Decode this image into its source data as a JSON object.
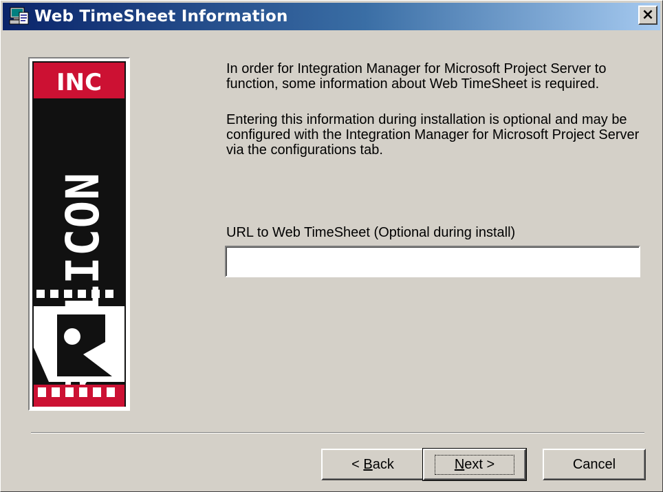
{
  "window": {
    "title": "Web TimeSheet Information",
    "close_label": "×"
  },
  "logo": {
    "top_text": "INC",
    "wordmark": "REPLICON",
    "letter": "R",
    "colors": {
      "red": "#cc1133",
      "black": "#111111",
      "white": "#ffffff"
    }
  },
  "content": {
    "info_paragraph_1": "In order for Integration Manager for Microsoft Project Server to function, some information about Web TimeSheet is required.",
    "info_paragraph_2": "Entering this information during installation is optional and may be configured with the Integration Manager for Microsoft Project Server via the configurations tab.",
    "url_label": "URL to Web TimeSheet   (Optional during install)",
    "url_value": ""
  },
  "buttons": {
    "back": {
      "prefix": "< ",
      "accel": "B",
      "rest": "ack"
    },
    "next": {
      "accel": "N",
      "rest": "ext >"
    },
    "cancel": "Cancel"
  },
  "icons": {
    "title_icon": "setup-computer-icon",
    "close_icon": "close-icon"
  }
}
